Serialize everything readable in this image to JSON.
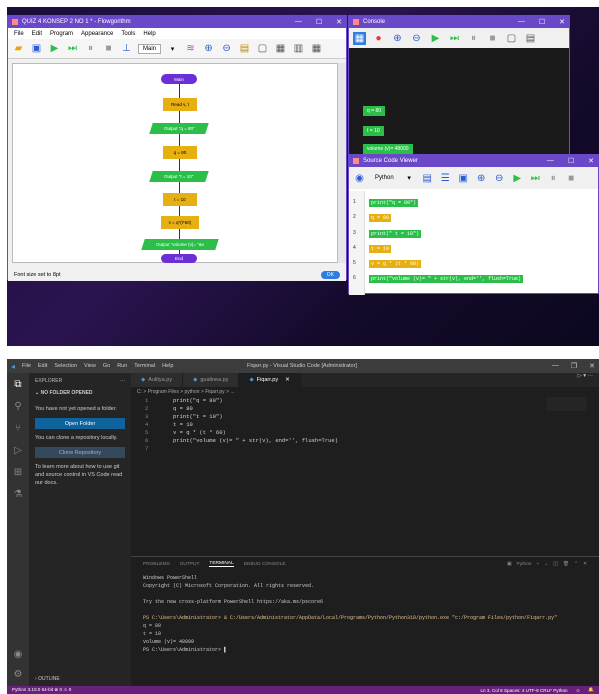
{
  "flowgorithm": {
    "title": "QUIZ 4 KONSEP 2 NO 1 * - Flowgorithm",
    "menu": [
      "File",
      "Edit",
      "Program",
      "Appearance",
      "Tools",
      "Help"
    ],
    "function_select": "Main",
    "nodes": [
      "Main",
      "Read v, t",
      "Output \"q = 80\"",
      "q = 80",
      "Output \"t = 10\"",
      "t = 10",
      "v = q*(t*60)",
      "Output \"volume (v)= \"&v",
      "End"
    ],
    "status": "Font size set to 8pt",
    "ok": "OK"
  },
  "console": {
    "title": "Console",
    "messages": [
      "q = 80",
      "t = 10",
      "volume (v)= 48000"
    ]
  },
  "source": {
    "title": "Source Code Viewer",
    "language": "Python",
    "line_numbers": [
      "1",
      "2",
      "3",
      "4",
      "5",
      "6"
    ],
    "lines": [
      "print(\"q = 80\")",
      "q = 80",
      "print(\" t = 10\")",
      "t = 10",
      "v = q * (t * 60)",
      "print(\"volume (v)= \" + str(v), end='', flush=True)"
    ]
  },
  "vscode": {
    "menu": [
      "File",
      "Edit",
      "Selection",
      "View",
      "Go",
      "Run",
      "Terminal",
      "Help"
    ],
    "title": "Fiqarr.py - Visual Studio Code [Administrator]",
    "explorer_title": "EXPLORER",
    "no_folder": "NO FOLDER OPENED",
    "no_folder_msg": "You have not yet opened a folder.",
    "open_folder": "Open Folder",
    "clone_msg": "You can clone a repository locally.",
    "clone_btn": "Clone Repository",
    "learn_msg": "To learn more about how to use git and source control in VS Code read our docs.",
    "outline": "OUTLINE",
    "tabs": [
      "Aulitya.py",
      "gualinea.py",
      "Fiqarr.py"
    ],
    "breadcrumb": "C: > Program Files > python > Fiqarr.py > ...",
    "line_numbers": [
      "1",
      "2",
      "3",
      "4",
      "5",
      "6",
      "7"
    ],
    "code": [
      "print(\"q = 80\")",
      "q = 80",
      "print(\"t = 10\")",
      "t = 10",
      "v = q * (t * 60)",
      "print(\"volume (v)= \" + str(v), end='', flush=True)",
      ""
    ],
    "panel_tabs": [
      "PROBLEMS",
      "OUTPUT",
      "TERMINAL",
      "DEBUG CONSOLE"
    ],
    "terminal_shell": "Python",
    "terminal": [
      "Windows PowerShell",
      "Copyright (C) Microsoft Corporation. All rights reserved.",
      "",
      "Try the new cross-platform PowerShell https://aka.ms/pscore6",
      "",
      "PS C:\\Users\\Administrator> & C:/Users/Administrator/AppData/Local/Programs/Python/Python310/python.exe \"c:/Program Files/python/Fiqarr.py\"",
      "q = 80",
      "t = 10",
      "volume (v)= 48000",
      "PS C:\\Users\\Administrator> ▌"
    ],
    "status_left": "Python 3.10.0 64-bit   ⊗ 0 ⚠ 0",
    "status_right": "Ln 3, Col 8   Spaces: 4   UTF-8   CRLF   Python"
  },
  "colors": {
    "flowgo_purple": "#6a49c8",
    "vs_status": "#68217a",
    "output_green": "#2bbf4a",
    "assign_yellow": "#e6b012"
  }
}
